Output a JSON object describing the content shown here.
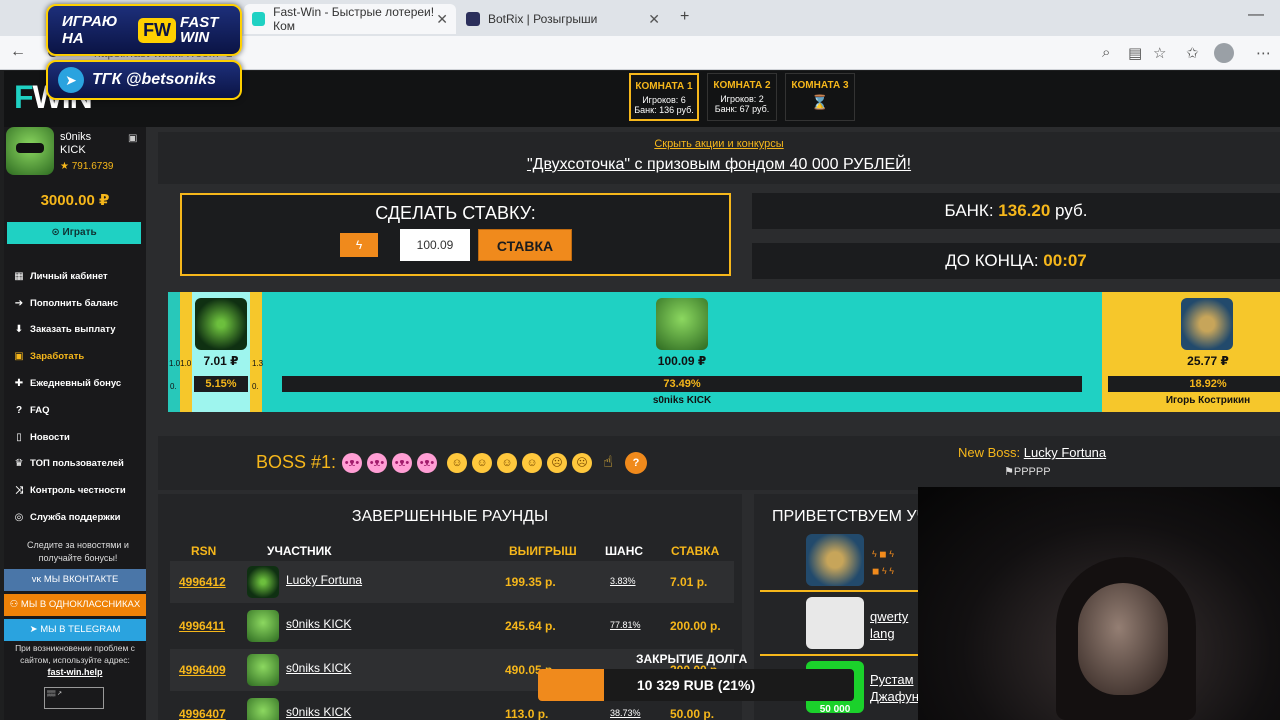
{
  "browser": {
    "tabs": [
      {
        "title": "Fast-Win - Быстрые лотереи! Ком"
      },
      {
        "title": "BotRix | Розыгрыши"
      }
    ],
    "url": "https://fast-win.../?room=1"
  },
  "overlay": {
    "badge1_text": "ИГРАЮ НА",
    "badge1_brand": "FAST WIN",
    "badge2_text": "ТГК @betsoniks"
  },
  "header": {
    "logo": "WIN",
    "rooms": [
      {
        "name": "КОМНАТА 1",
        "players": "Игроков: 6",
        "bank": "Банк: 136 руб."
      },
      {
        "name": "КОМНАТА 2",
        "players": "Игроков: 2",
        "bank": "Банк: 67 руб."
      },
      {
        "name": "КОМНАТА 3"
      }
    ]
  },
  "sidebar": {
    "user_name": "s0niks",
    "user_name2": "KICK",
    "user_rating": "★ 791.6739",
    "balance": "3000.00 ₽",
    "play_button": "Играть",
    "menu": [
      {
        "label": "Личный кабинет",
        "icon": "cabinet-icon"
      },
      {
        "label": "Пополнить баланс",
        "icon": "deposit-icon"
      },
      {
        "label": "Заказать выплату",
        "icon": "withdraw-icon"
      },
      {
        "label": "Заработать",
        "icon": "earn-icon"
      },
      {
        "label": "Ежедневный бонус",
        "icon": "gift-icon"
      },
      {
        "label": "FAQ",
        "icon": "faq-icon"
      },
      {
        "label": "Новости",
        "icon": "news-icon"
      },
      {
        "label": "ТОП пользователей",
        "icon": "trophy-icon"
      },
      {
        "label": "Контроль честности",
        "icon": "shuffle-icon"
      },
      {
        "label": "Служба поддержки",
        "icon": "support-icon"
      }
    ],
    "follow_text": "Следите за новостями и получайте бонусы!",
    "vk": "МЫ ВКОНТАКТЕ",
    "ok": "МЫ В ОДНОКЛАССНИКАХ",
    "tg": "МЫ В TELEGRAM",
    "help_text": "При возникновении проблем с сайтом, используйте адрес:",
    "help_link": "fast-win.help"
  },
  "promo": {
    "hide_link": "Скрыть акции и конкурсы",
    "title": "\"Двухсоточка\" с призовым фондом 40 000 РУБЛЕЙ!"
  },
  "bet": {
    "title": "СДЕЛАТЬ СТАВКУ:",
    "value": "100.09",
    "button": "СТАВКА"
  },
  "stats": {
    "bank_label": "БАНК:",
    "bank_value": "136.20",
    "bank_unit": "руб.",
    "end_label": "ДО КОНЦА:",
    "end_value": "00:07"
  },
  "round": {
    "players": [
      {
        "amount": "7.01 ₽",
        "chance": "5.15%"
      },
      {
        "amount": "100.09 ₽",
        "chance": "73.49%",
        "name": "s0niks KICK"
      },
      {
        "amount": "25.77 ₽",
        "chance": "18.92%",
        "name": "Игорь Кострикин"
      }
    ],
    "tiny": {
      "a": "1.01.0",
      "b": "1.3",
      "c": "0.",
      "d": "0."
    }
  },
  "boss": {
    "label": "BOSS #1:",
    "new_boss_label": "New Boss:",
    "new_boss_name": "Lucky Fortuna",
    "flags": "⚑PPPPP"
  },
  "rounds": {
    "title": "ЗАВЕРШЕННЫЕ РАУНДЫ",
    "headers": {
      "rsn": "RSN",
      "participant": "УЧАСТНИК",
      "win": "ВЫИГРЫШ",
      "chance": "ШАНС",
      "stake": "СТАВКА"
    },
    "rows": [
      {
        "id": "4996412",
        "name": "Lucky Fortuna",
        "win": "199.35 р.",
        "chance": "3.83%",
        "stake": "7.01 р."
      },
      {
        "id": "4996411",
        "name": "s0niks KICK",
        "win": "245.64 р.",
        "chance": "77.81%",
        "stake": "200.00 р."
      },
      {
        "id": "4996409",
        "name": "s0niks KICK",
        "win": "490.05 р.",
        "chance": "",
        "stake": "200.00 р."
      },
      {
        "id": "4996407",
        "name": "s0niks KICK",
        "win": "113.0 р.",
        "chance": "38.73%",
        "stake": "50.00 р."
      }
    ]
  },
  "welcome": {
    "title": "ПРИВЕТСТВУЕМ УЧА",
    "users": [
      {
        "name": "",
        "name2": ""
      },
      {
        "name": "qwerty",
        "name2": "lang"
      },
      {
        "name": "Рустам",
        "name2": "Джафун"
      }
    ],
    "amount": "50 000"
  },
  "debt": {
    "label": "ЗАКРЫТИЕ ДОЛГА",
    "text": "10 329 RUB (21%)",
    "progress_percent": 21
  },
  "colors": {
    "accent": "#f6b71b",
    "teal": "#1fd1c3",
    "orange": "#f08a1c"
  }
}
